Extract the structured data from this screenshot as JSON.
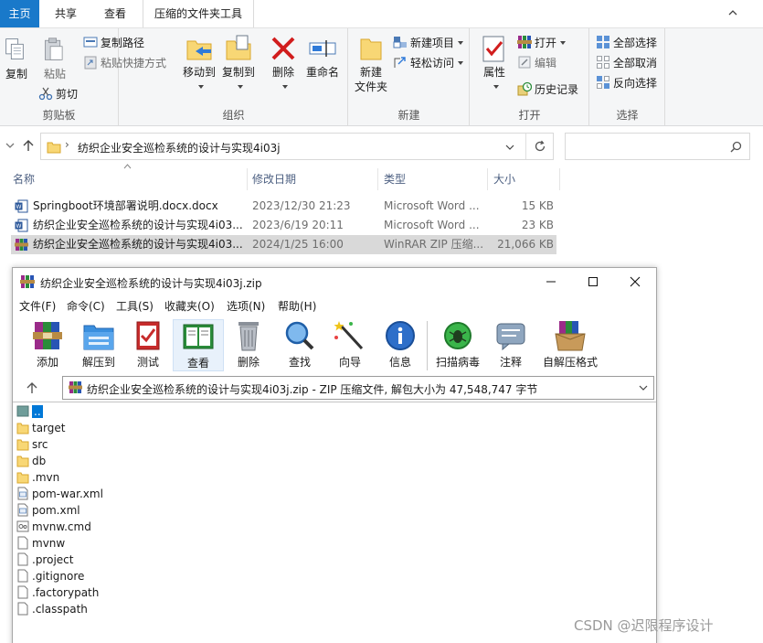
{
  "explorer": {
    "tabs": [
      "主页",
      "共享",
      "查看",
      "压缩的文件夹工具"
    ],
    "ribbon": {
      "clipboard": {
        "label": "剪贴板",
        "copy": "复制",
        "paste": "粘贴",
        "copy_path": "复制路径",
        "paste_shortcut": "粘贴快捷方式",
        "cut": "剪切"
      },
      "organize": {
        "label": "组织",
        "move_to": "移动到",
        "copy_to": "复制到",
        "delete": "删除",
        "rename": "重命名"
      },
      "new": {
        "label": "新建",
        "new_folder_line1": "新建",
        "new_folder_line2": "文件夹",
        "new_item": "新建项目",
        "easy_access": "轻松访问"
      },
      "open": {
        "label": "打开",
        "properties": "属性",
        "open": "打开",
        "edit": "编辑",
        "history": "历史记录"
      },
      "select": {
        "label": "选择",
        "select_all": "全部选择",
        "select_none": "全部取消",
        "invert": "反向选择"
      }
    },
    "address": "纺织企业安全巡检系统的设计与实现4i03j",
    "search_placeholder": "",
    "columns": [
      "名称",
      "修改日期",
      "类型",
      "大小"
    ],
    "files": [
      {
        "name": "Springboot环境部署说明.docx.docx",
        "date": "2023/12/30 21:23",
        "type": "Microsoft Word ...",
        "size": "15 KB",
        "icon": "word-icon"
      },
      {
        "name": "纺织企业安全巡检系统的设计与实现4i03...",
        "date": "2023/6/19 20:11",
        "type": "Microsoft Word ...",
        "size": "23 KB",
        "icon": "word-icon"
      },
      {
        "name": "纺织企业安全巡检系统的设计与实现4i03...",
        "date": "2024/1/25 16:00",
        "type": "WinRAR ZIP 压缩...",
        "size": "21,066 KB",
        "icon": "winrar-icon"
      }
    ]
  },
  "winrar": {
    "title": "纺织企业安全巡检系统的设计与实现4i03j.zip",
    "menu": [
      "文件(F)",
      "命令(C)",
      "工具(S)",
      "收藏夹(O)",
      "选项(N)",
      "帮助(H)"
    ],
    "tools": [
      "添加",
      "解压到",
      "测试",
      "查看",
      "删除",
      "查找",
      "向导",
      "信息",
      "扫描病毒",
      "注释",
      "自解压格式"
    ],
    "path": "纺织企业安全巡检系统的设计与实现4i03j.zip - ZIP 压缩文件, 解包大小为 47,548,747 字节",
    "items": [
      {
        "name": "..",
        "kind": "up"
      },
      {
        "name": "target",
        "kind": "folder"
      },
      {
        "name": "src",
        "kind": "folder"
      },
      {
        "name": "db",
        "kind": "folder"
      },
      {
        "name": ".mvn",
        "kind": "folder"
      },
      {
        "name": "pom-war.xml",
        "kind": "xml"
      },
      {
        "name": "pom.xml",
        "kind": "xml"
      },
      {
        "name": "mvnw.cmd",
        "kind": "cmd"
      },
      {
        "name": "mvnw",
        "kind": "file"
      },
      {
        "name": ".project",
        "kind": "file"
      },
      {
        "name": ".gitignore",
        "kind": "file"
      },
      {
        "name": ".factorypath",
        "kind": "file"
      },
      {
        "name": ".classpath",
        "kind": "file"
      }
    ]
  },
  "watermark": "CSDN @迟限程序设计"
}
